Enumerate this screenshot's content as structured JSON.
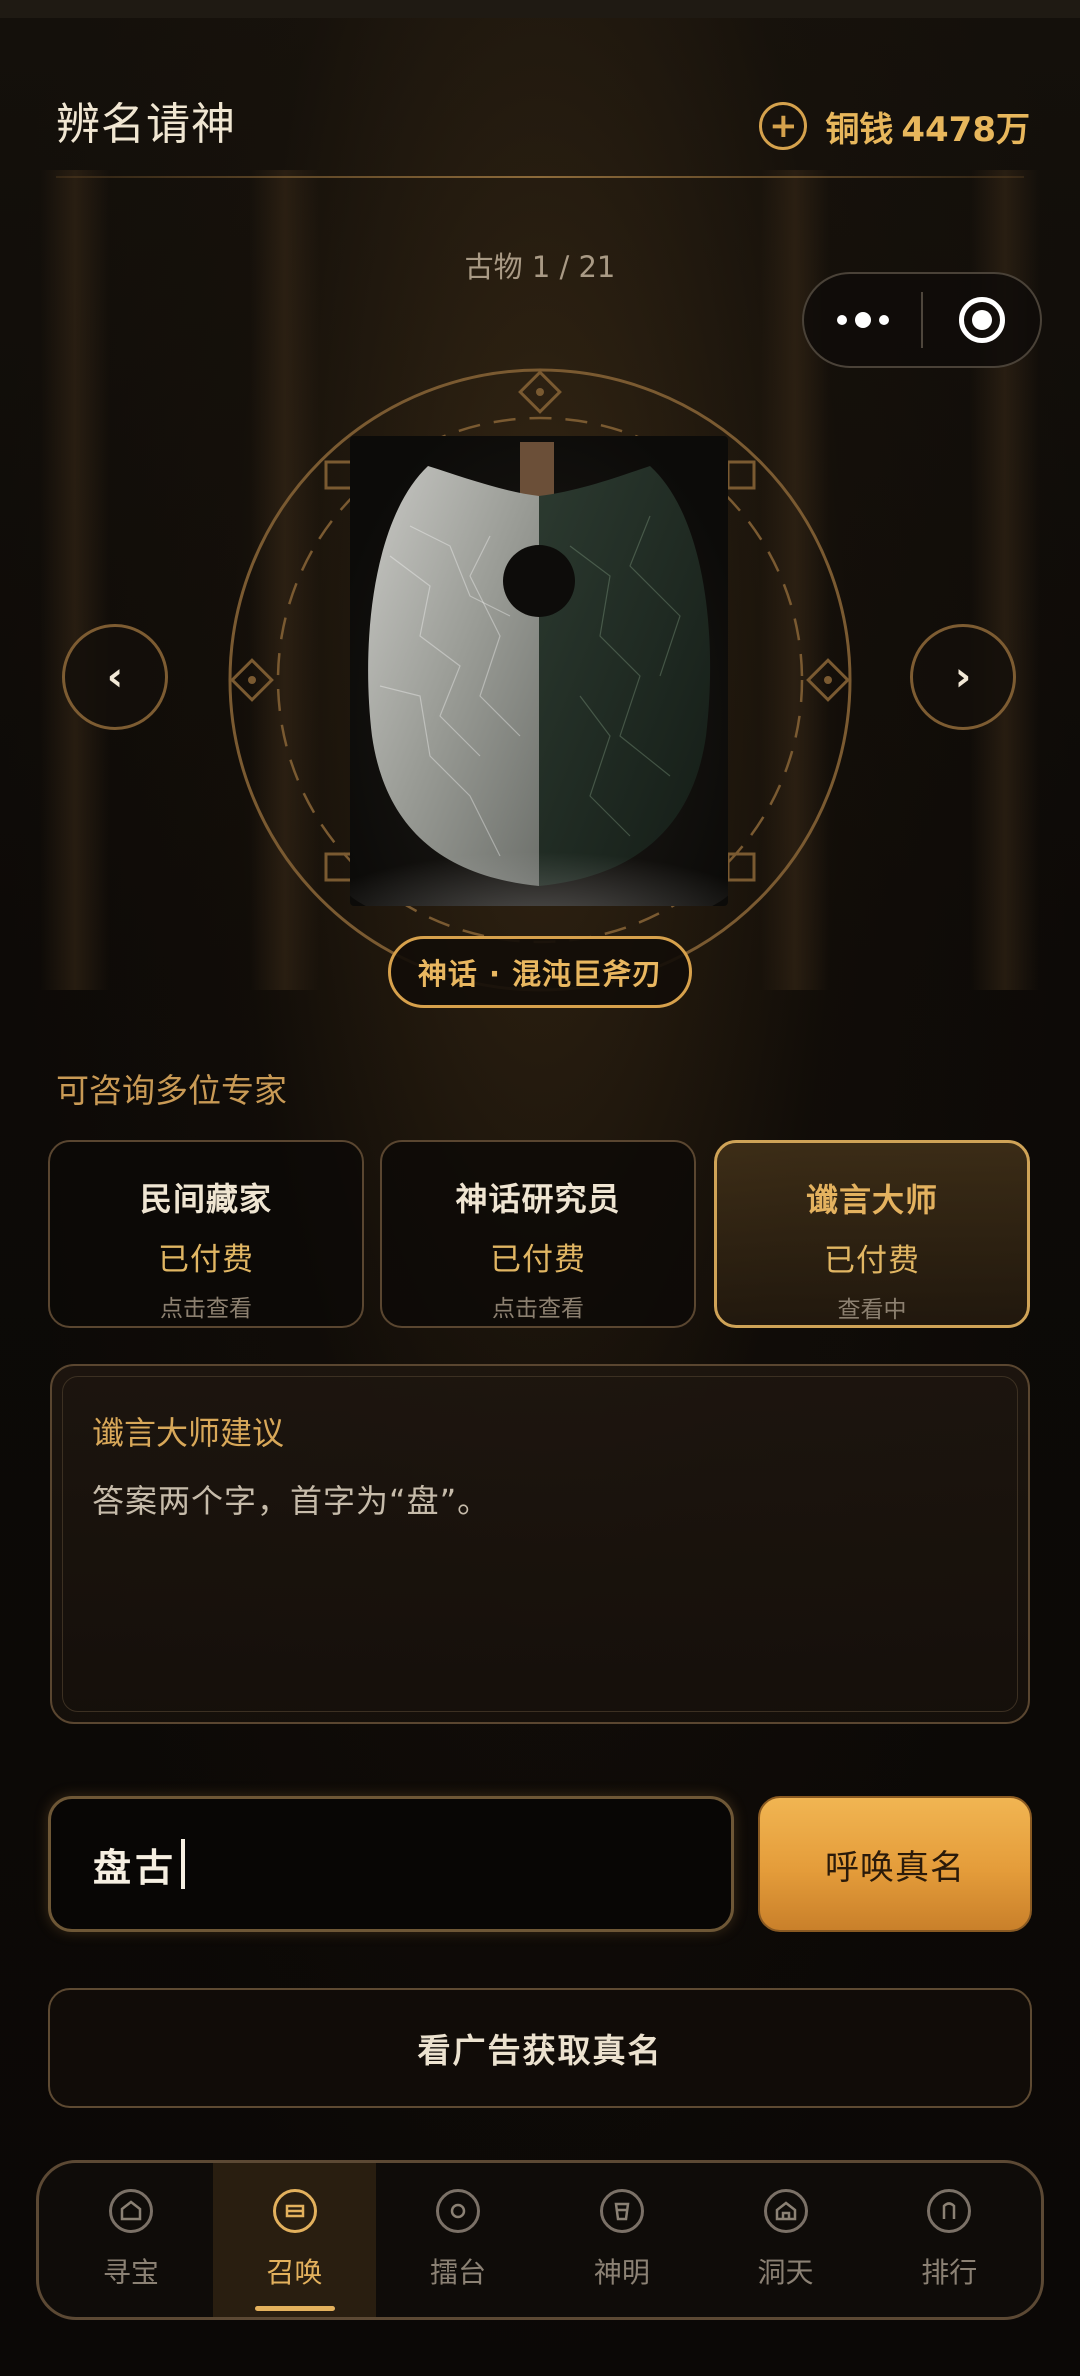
{
  "header": {
    "title": "辨名请神",
    "currency_label": "铜钱",
    "currency_value": "4478万"
  },
  "artifact": {
    "counter": "古物 1 / 21",
    "name": "神话 · 混沌巨斧刃"
  },
  "experts": {
    "heading": "可咨询多位专家",
    "cards": [
      {
        "name": "民间藏家",
        "status": "已付费",
        "hint": "点击查看"
      },
      {
        "name": "神话研究员",
        "status": "已付费",
        "hint": "点击查看"
      },
      {
        "name": "谶言大师",
        "status": "已付费",
        "hint": "查看中"
      }
    ]
  },
  "advice": {
    "title": "谶言大师建议",
    "text": "答案两个字，首字为“盘”。"
  },
  "answer": {
    "value": "盘古",
    "submit_label": "呼唤真名",
    "ad_label": "看广告获取真名"
  },
  "tabs": [
    {
      "label": "寻宝",
      "icon": "treasure-icon"
    },
    {
      "label": "召唤",
      "icon": "summon-icon",
      "active": true
    },
    {
      "label": "擂台",
      "icon": "arena-icon"
    },
    {
      "label": "神明",
      "icon": "deity-icon"
    },
    {
      "label": "洞天",
      "icon": "home-icon"
    },
    {
      "label": "排行",
      "icon": "rank-icon"
    }
  ],
  "colors": {
    "accent": "#e3b15d",
    "background": "#0c0906",
    "button": "#e49c3a"
  }
}
